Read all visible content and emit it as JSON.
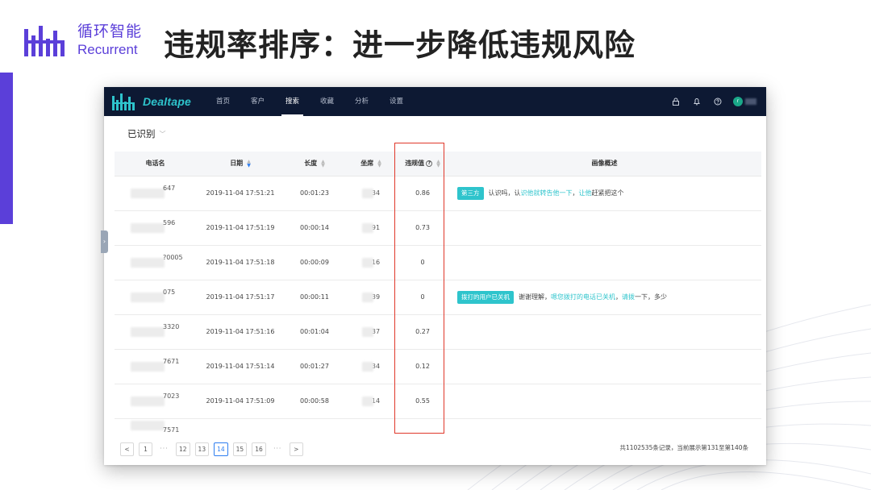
{
  "slide": {
    "brand_cn": "循环智能",
    "brand_en": "Recurrent",
    "title": "违规率排序：进一步降低违规风险"
  },
  "app": {
    "logo_text": "Dealtape",
    "nav": [
      "首页",
      "客户",
      "搜索",
      "收藏",
      "分析",
      "设置"
    ],
    "nav_active_index": 2,
    "nav_icons": [
      "lock-icon",
      "bell-icon",
      "help-icon"
    ],
    "avatar_initial": "r"
  },
  "section": {
    "title": "已识别",
    "caret": "﹀"
  },
  "table": {
    "columns": [
      "电话名",
      "日期",
      "长度",
      "坐席",
      "违规值",
      "画像概述"
    ],
    "rows": [
      {
        "phone_tail": "647",
        "date": "2019-11-04 17:51:21",
        "duration": "00:01:23",
        "seat_tail": "34",
        "score": "0.86",
        "tag": "第三方",
        "summary": [
          {
            "t": "认识吗，认",
            "hl": false
          },
          {
            "t": "识他就转告他一下",
            "hl": true
          },
          {
            "t": "，",
            "hl": false
          },
          {
            "t": "让他",
            "hl": true
          },
          {
            "t": "赶紧把这个",
            "hl": false
          }
        ]
      },
      {
        "phone_tail": "596",
        "date": "2019-11-04 17:51:19",
        "duration": "00:00:14",
        "seat_tail": "91",
        "score": "0.73",
        "tag": "",
        "summary": []
      },
      {
        "phone_tail": "?0005",
        "date": "2019-11-04 17:51:18",
        "duration": "00:00:09",
        "seat_tail": "16",
        "score": "0",
        "tag": "",
        "summary": []
      },
      {
        "phone_tail": "075",
        "date": "2019-11-04 17:51:17",
        "duration": "00:00:11",
        "seat_tail": "39",
        "score": "0",
        "tag": "拨打的用户已关机",
        "summary": [
          {
            "t": "谢谢理解，",
            "hl": false
          },
          {
            "t": "嗯您拨打的电话已关机",
            "hl": true
          },
          {
            "t": "，",
            "hl": false
          },
          {
            "t": "请拨",
            "hl": true
          },
          {
            "t": "一下，多少",
            "hl": false
          }
        ]
      },
      {
        "phone_tail": "3320",
        "date": "2019-11-04 17:51:16",
        "duration": "00:01:04",
        "seat_tail": "37",
        "score": "0.27",
        "tag": "",
        "summary": []
      },
      {
        "phone_tail": "7671",
        "date": "2019-11-04 17:51:14",
        "duration": "00:01:27",
        "seat_tail": "34",
        "score": "0.12",
        "tag": "",
        "summary": []
      },
      {
        "phone_tail": "7023",
        "date": "2019-11-04 17:51:09",
        "duration": "00:00:58",
        "seat_tail": "14",
        "score": "0.55",
        "tag": "",
        "summary": []
      },
      {
        "phone_tail": "7571",
        "date": "",
        "duration": "",
        "seat_tail": "",
        "score": "",
        "tag": "",
        "summary": []
      }
    ]
  },
  "pagination": {
    "prev": "<",
    "next": ">",
    "pages": [
      "1",
      "···",
      "12",
      "13",
      "14",
      "15",
      "16",
      "···"
    ],
    "current": "14",
    "info": "共1102535条记录，当前展示第131至第140条"
  },
  "colors": {
    "brand_purple": "#5b3fd9",
    "navbar": "#0d1933",
    "accent_teal": "#2ec4cc",
    "highlight_red": "#e0382b",
    "pager_blue": "#2e7ef0"
  }
}
